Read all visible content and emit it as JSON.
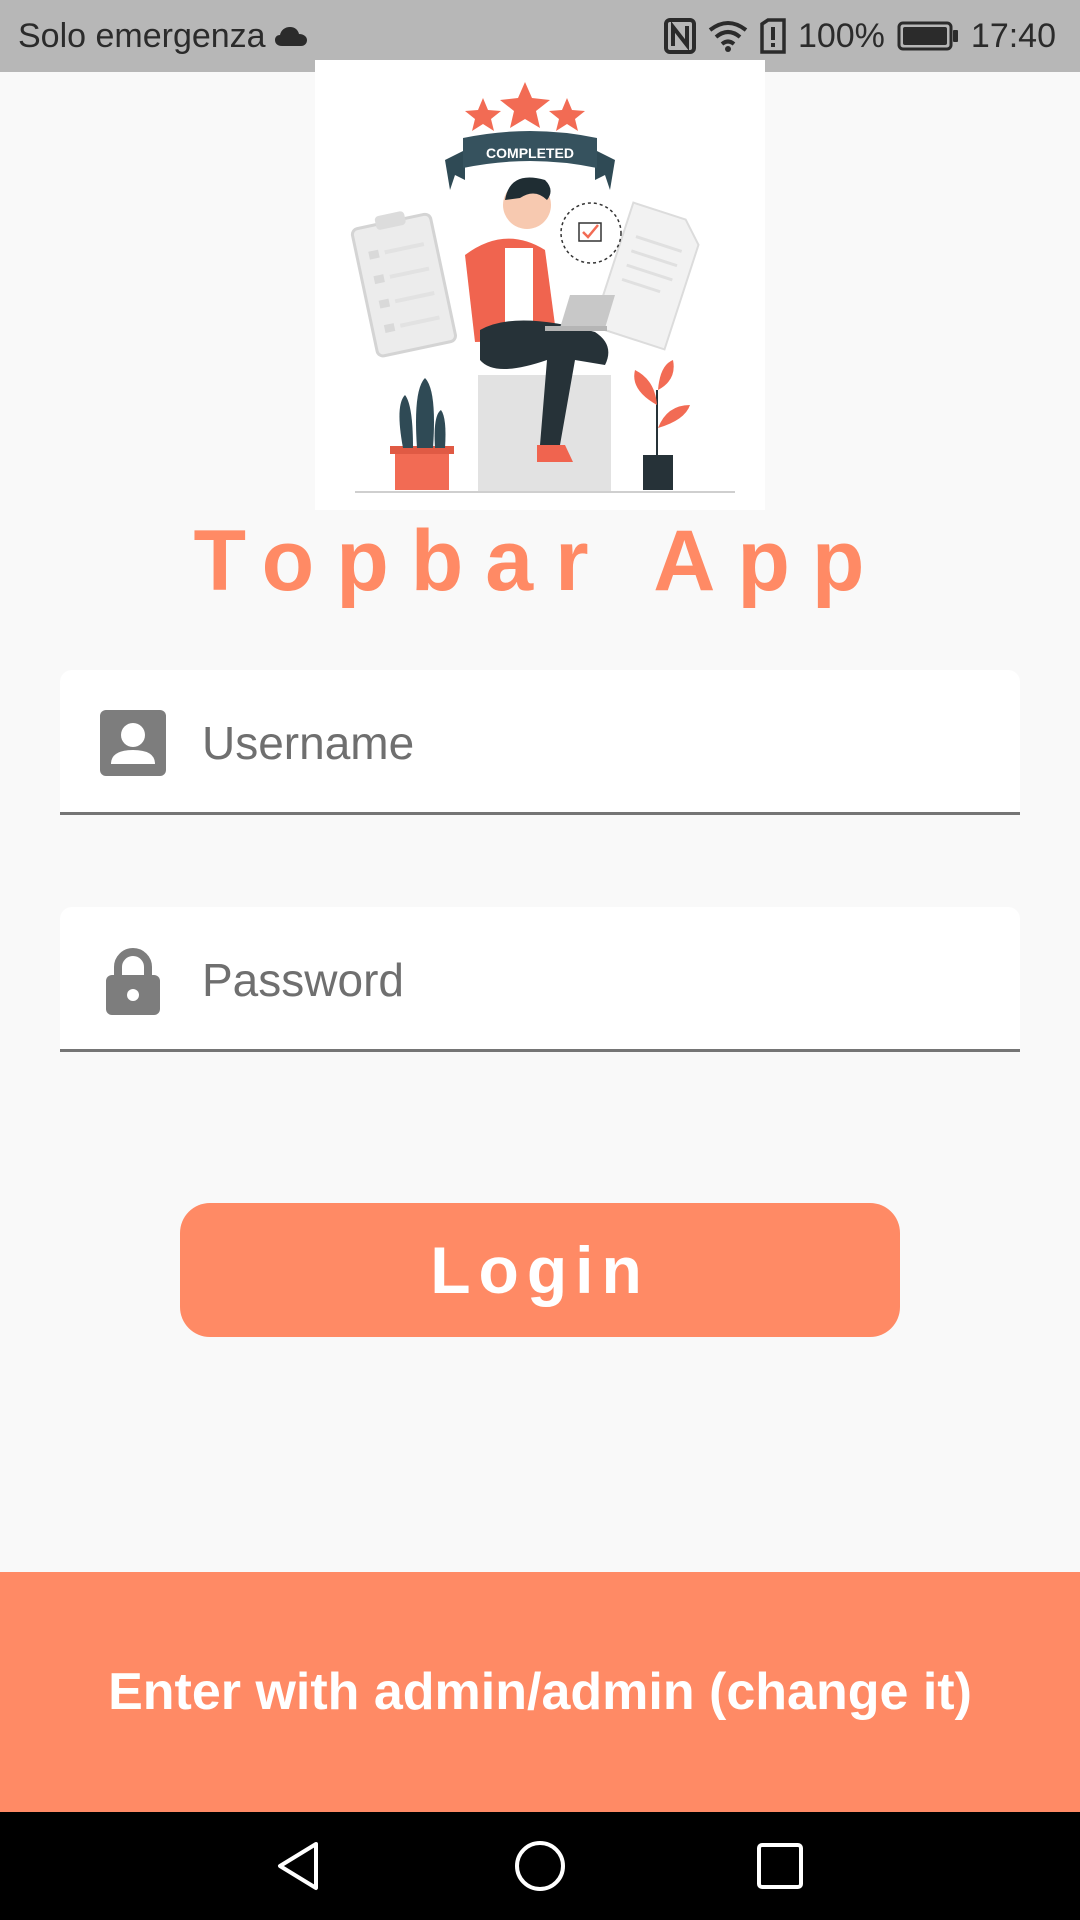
{
  "status_bar": {
    "carrier": "Solo emergenza",
    "battery": "100%",
    "time": "17:40",
    "icons": [
      "cloud-icon",
      "nfc-icon",
      "wifi-icon",
      "sim-alert-icon",
      "battery-icon"
    ]
  },
  "app": {
    "title": "Topbar App",
    "illustration_banner": "COMPLETED",
    "accent_color": "#ff8a65"
  },
  "form": {
    "username_placeholder": "Username",
    "password_placeholder": "Password",
    "login_label": "Login"
  },
  "banner": {
    "message": "Enter with admin/admin (change it)"
  },
  "nav": {
    "icons": [
      "back-icon",
      "home-icon",
      "recents-icon"
    ]
  }
}
